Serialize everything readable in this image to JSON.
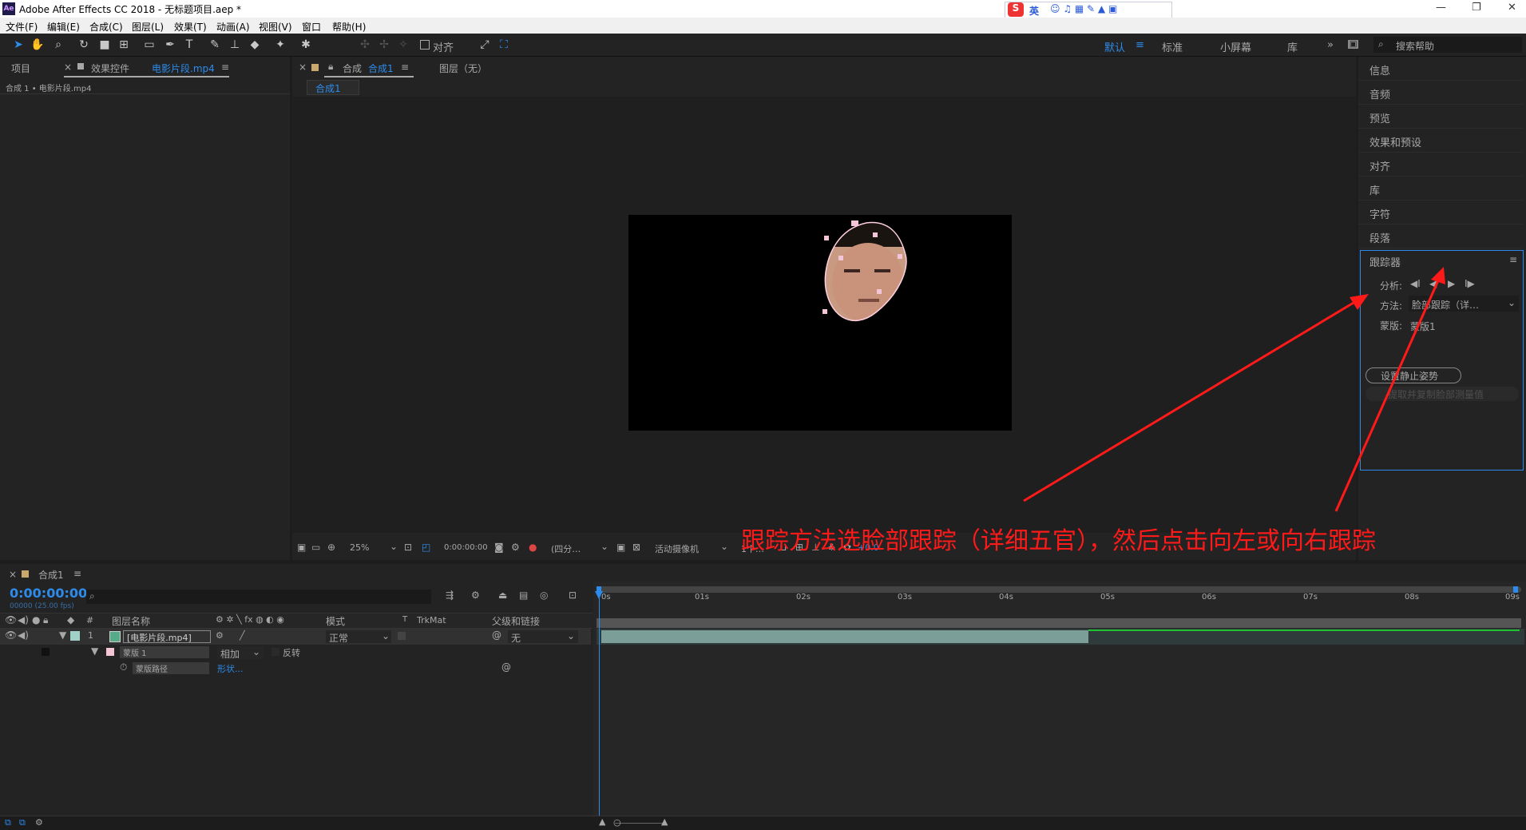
{
  "window": {
    "title": "Adobe After Effects CC 2018 - 无标题项目.aep *",
    "logo": "Ae",
    "minimize": "—",
    "restore": "❐",
    "close": "✕"
  },
  "ime": {
    "label": "英"
  },
  "menu": [
    "文件(F)",
    "编辑(E)",
    "合成(C)",
    "图层(L)",
    "效果(T)",
    "动画(A)",
    "视图(V)",
    "窗口",
    "帮助(H)"
  ],
  "toolbar": {
    "align_label": "对齐",
    "workspaces": [
      "默认",
      "标准",
      "小屏幕",
      "库"
    ],
    "search_placeholder": "搜索帮助"
  },
  "left_panel": {
    "tab_project": "项目",
    "tab_effects_prefix": "效果控件",
    "tab_effects_file": "电影片段.mp4",
    "breadcrumb": "合成 1 • 电影片段.mp4"
  },
  "comp_panel": {
    "tab_prefix": "合成",
    "tab_name": "合成1",
    "layer_tab": "图层（无）",
    "subtab": "合成1",
    "zoom": "25%",
    "timecode": "0:00:00:00",
    "resolution": "(四分…",
    "camera": "活动摄像机",
    "views": "1个…",
    "exposure": "+0.0"
  },
  "right_panel": {
    "items": [
      "信息",
      "音频",
      "预览",
      "效果和预设",
      "对齐",
      "库",
      "字符",
      "段落"
    ],
    "tracker_title": "跟踪器",
    "analyze_label": "分析:",
    "method_label": "方法:",
    "method_value": "脸部跟踪（详…",
    "mask_label": "蒙版:",
    "mask_value": "蒙版1",
    "set_rest_pose": "设置静止姿势",
    "extract_copy": "提取并复制脸部测量值"
  },
  "annotation": {
    "text": "跟踪方法选脸部跟踪（详细五官），然后点击向左或向右跟踪",
    "color": "#ff1a1a"
  },
  "timeline": {
    "tab": "合成1",
    "timecode": "0:00:00:00",
    "fps": "00000 (25.00 fps)",
    "headers": {
      "num": "#",
      "name": "图层名称",
      "mode": "模式",
      "t": "T",
      "trkmat": "TrkMat",
      "parent": "父级和链接"
    },
    "layer": {
      "index": "1",
      "name": "[电影片段.mp4]",
      "mode": "正常",
      "parent": "无"
    },
    "mask": {
      "name": "蒙版 1",
      "mode": "相加",
      "invert": "反转"
    },
    "mask_path": {
      "name": "蒙版路径",
      "value": "形状..."
    },
    "ruler": [
      "0s",
      "01s",
      "02s",
      "03s",
      "04s",
      "05s",
      "06s",
      "07s",
      "08s",
      "09s"
    ]
  }
}
